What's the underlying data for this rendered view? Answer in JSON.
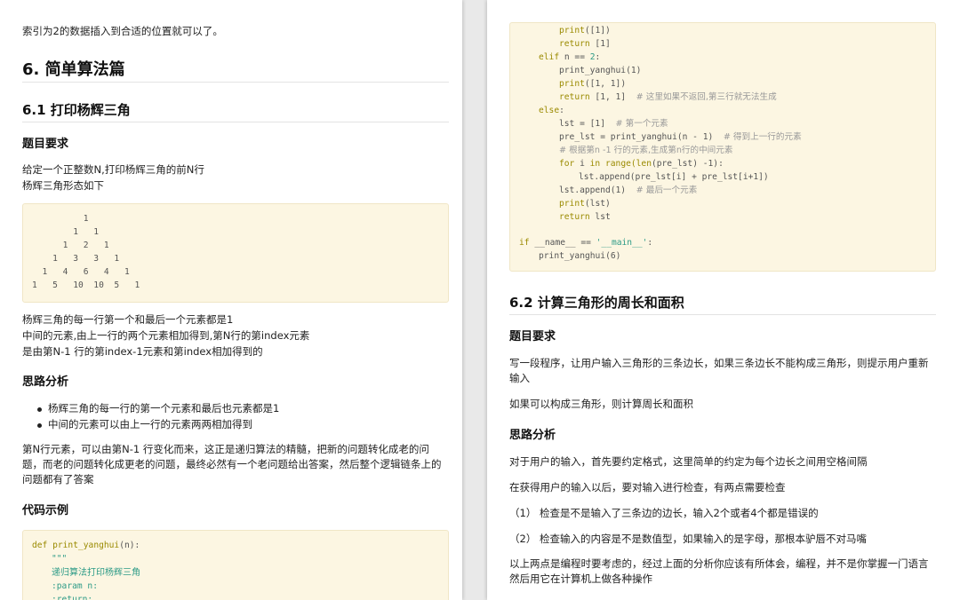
{
  "left": {
    "top_text": "索引为2的数据插入到合适的位置就可以了。",
    "h_algo": "6. 简单算法篇",
    "h_yanghui": "6.1 打印杨辉三角",
    "h_req": "题目要求",
    "req_lines": [
      "给定一个正整数N,打印杨辉三角的前N行",
      "杨辉三角形态如下"
    ],
    "triangle_lines": [
      "          1",
      "        1   1",
      "      1   2   1",
      "    1   3   3   1",
      "  1   4   6   4   1",
      "1   5   10  10  5   1"
    ],
    "desc_lines": [
      "杨辉三角的每一行第一个和最后一个元素都是1",
      "中间的元素,由上一行的两个元素相加得到,第N行的第index元素",
      "是由第N-1 行的第index-1元素和第index相加得到的"
    ],
    "h_analysis": "思路分析",
    "bullets": [
      "杨辉三角的每一行的第一个元素和最后也元素都是1",
      "中间的元素可以由上一行的元素两两相加得到"
    ],
    "para_lines": [
      "第N行元素，可以由第N-1 行变化而来，这正是递归算法的精髓，把新的问题转化成老的问",
      "题，而老的问题转化成更老的问题，最终必然有一个老问题给出答案，然后整个逻辑链条上的",
      "问题都有了答案"
    ],
    "h_code": "代码示例",
    "code_def": "def",
    "code_fn": "print_yanghui",
    "code_param": "(n):",
    "code_doc_open": "\"\"\"",
    "code_doc_desc": "递归算法打印杨辉三角",
    "code_doc_param": ":param n:",
    "code_doc_return": ":return:"
  },
  "right": {
    "code": {
      "l1_print": "print",
      "l1_args": "([1])",
      "l2_return": "return",
      "l2_val": " [1]",
      "l3_elif": "elif",
      "l3_cond": " n == ",
      "l3_num": "2",
      "l3_colon": ":",
      "l4": "print_yanghui(1)",
      "l5_print": "print",
      "l5_args": "([1, 1])",
      "l6_return": "return",
      "l6_val": " [1, 1]  ",
      "l6_comment": "# 这里如果不返回,第三行就无法生成",
      "l7_else": "else",
      "l7_colon": ":",
      "l8_code": "lst = [1]  ",
      "l8_comment": "# 第一个元素",
      "l9_code": "pre_lst = print_yanghui(n - 1)  ",
      "l9_comment": "# 得到上一行的元素",
      "l10_comment": "# 根据第n -1 行的元素,生成第n行的中间元素",
      "l11_for": "for",
      "l11_i": " i ",
      "l11_in": "in",
      "l11_range": " range",
      "l11_len": "(len",
      "l11_rest": "(pre_lst) -1):",
      "l12": "lst.append(pre_lst[i] + pre_lst[i+1])",
      "l13_code": "lst.append(1)  ",
      "l13_comment": "# 最后一个元素",
      "l14_print": "print",
      "l14_args": "(lst)",
      "l15_return": "return",
      "l15_val": " lst",
      "l16_if": "if",
      "l16_name": " __name__ == ",
      "l16_str": "'__main__'",
      "l16_colon": ":",
      "l17": "print_yanghui(6)"
    },
    "h_triangle": "6.2 计算三角形的周长和面积",
    "h_req": "题目要求",
    "req_lines": [
      "写一段程序，让用户输入三角形的三条边长，如果三条边长不能构成三角形，则提示用户重新",
      "输入"
    ],
    "req_line2": "如果可以构成三角形，则计算周长和面积",
    "h_analysis": "思路分析",
    "p1": "对于用户的输入，首先要约定格式，这里简单的约定为每个边长之间用空格间隔",
    "p2": "在获得用户的输入以后，要对输入进行检查，有两点需要检查",
    "p3": "（1） 检查是不是输入了三条边的边长，输入2个或者4个都是错误的",
    "p4": "（2） 检查输入的内容是不是数值型，如果输入的是字母，那根本驴唇不对马嘴",
    "p5_lines": [
      "以上两点是编程时要考虑的，经过上面的分析你应该有所体会，编程，并不是你掌握一门语言",
      "然后用它在计算机上做各种操作"
    ]
  }
}
